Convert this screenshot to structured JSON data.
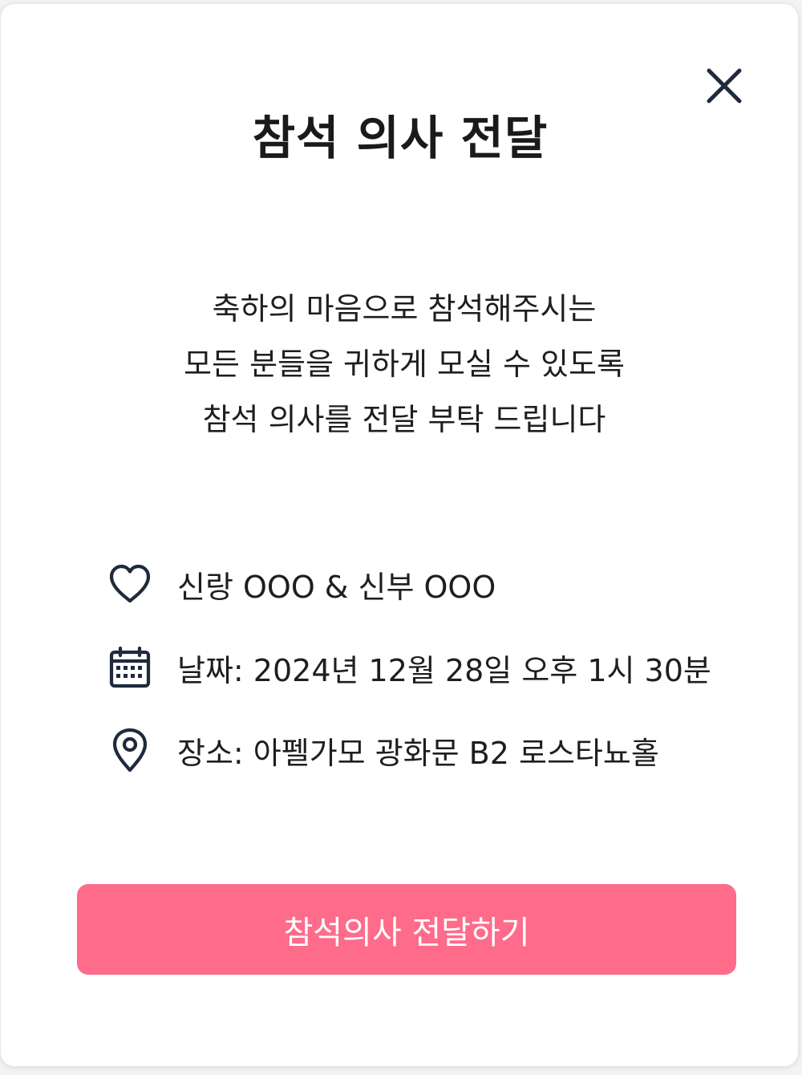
{
  "modal": {
    "title": "참석 의사 전달",
    "close_icon": "close-icon",
    "message_lines": [
      "축하의 마음으로 참석해주시는",
      "모든 분들을 귀하게 모실 수 있도록",
      "참석 의사를 전달 부탁 드립니다"
    ],
    "info": {
      "couple": {
        "icon": "heart-icon",
        "text": "신랑 OOO & 신부 OOO"
      },
      "date": {
        "icon": "calendar-icon",
        "text": "날짜: 2024년 12월 28일 오후 1시 30분"
      },
      "place": {
        "icon": "location-pin-icon",
        "text": "장소: 아펠가모 광화문 B2 로스타뇨홀"
      }
    },
    "submit_label": "참석의사 전달하기"
  },
  "colors": {
    "accent": "#ff6b8b",
    "icon": "#1f2a3c",
    "text": "#1e1e1e"
  }
}
